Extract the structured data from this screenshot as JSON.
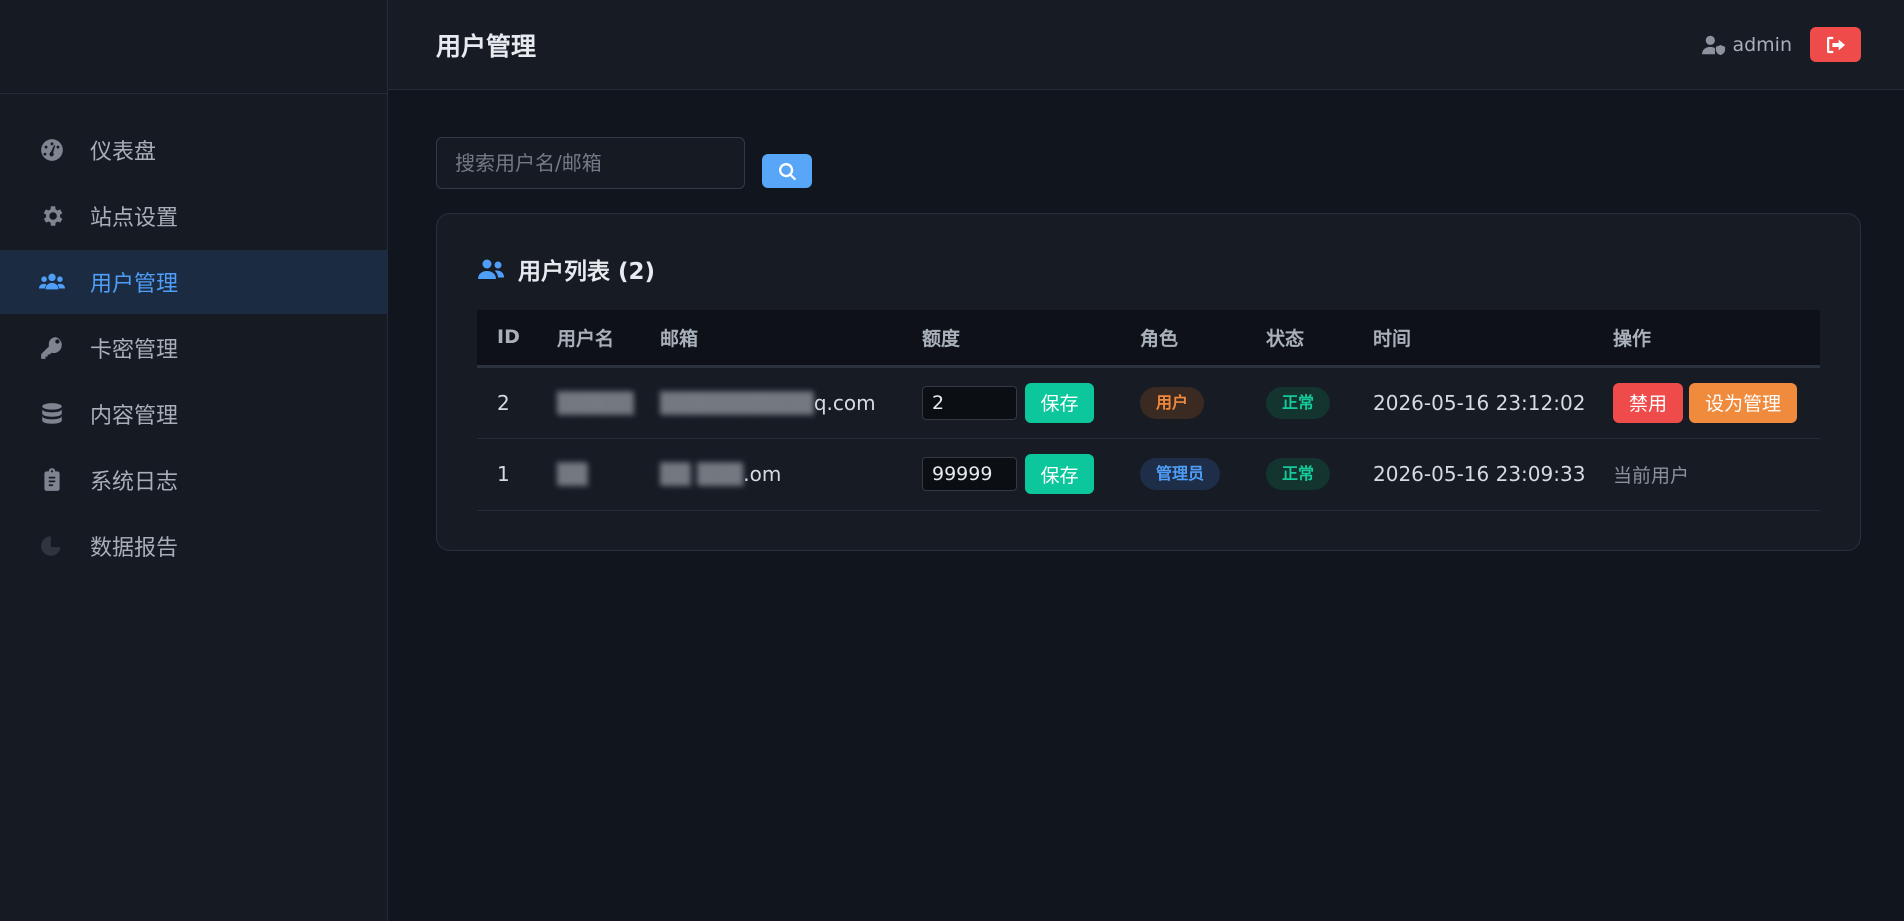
{
  "sidebar": {
    "items": [
      {
        "label": "仪表盘",
        "icon": "dashboard-icon",
        "active": false
      },
      {
        "label": "站点设置",
        "icon": "gear-icon",
        "active": false
      },
      {
        "label": "用户管理",
        "icon": "users-icon",
        "active": true
      },
      {
        "label": "卡密管理",
        "icon": "key-icon",
        "active": false
      },
      {
        "label": "内容管理",
        "icon": "database-icon",
        "active": false
      },
      {
        "label": "系统日志",
        "icon": "clipboard-icon",
        "active": false
      },
      {
        "label": "数据报告",
        "icon": "chart-icon",
        "active": false
      }
    ]
  },
  "header": {
    "title": "用户管理",
    "username": "admin"
  },
  "search": {
    "placeholder": "搜索用户名/邮箱"
  },
  "users_card": {
    "title": "用户列表 (2)",
    "columns": [
      "ID",
      "用户名",
      "邮箱",
      "额度",
      "角色",
      "状态",
      "时间",
      "操作"
    ],
    "rows": [
      {
        "id": "2",
        "username": "▒▒▒▒▒",
        "email_hidden": "▒▒▒▒▒▒▒▒▒▒",
        "email_suffix": "q.com",
        "quota": "2",
        "save_label": "保存",
        "role": "用户",
        "status": "正常",
        "time": "2026-05-16 23:12:02",
        "actions": {
          "ban": "禁用",
          "make_admin": "设为管理"
        }
      },
      {
        "id": "1",
        "username": "▒▒",
        "email_hidden": "▒▒  ▒▒▒",
        "email_suffix": ".om",
        "quota": "99999",
        "save_label": "保存",
        "role": "管理员",
        "status": "正常",
        "time": "2026-05-16 23:09:33",
        "current_user_label": "当前用户"
      }
    ]
  },
  "colors": {
    "accent": "#4f9ef8",
    "success": "#0cc79c",
    "danger": "#ef4b4b",
    "warning": "#f08a3c",
    "background": "#11151d"
  }
}
